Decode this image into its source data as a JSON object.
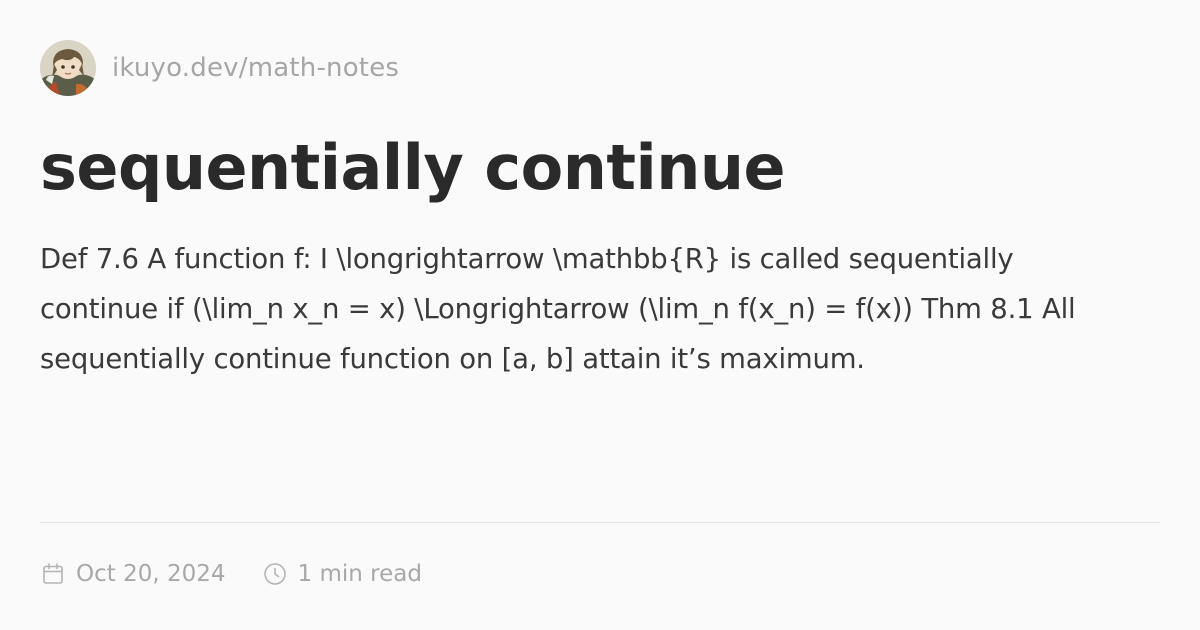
{
  "site": {
    "avatar_icon": "avatar-illustration",
    "url": "ikuyo.dev/math-notes"
  },
  "post": {
    "title": "sequentially continue",
    "excerpt": "Def 7.6 A function f: I \\longrightarrow \\mathbb{R} is called sequentially continue if (\\lim_n x_n = x) \\Longrightarrow (\\lim_n f(x_n) = f(x)) Thm 8.1 All sequentially continue function on [a, b] attain it’s maximum."
  },
  "meta": {
    "date_icon": "calendar-icon",
    "date": "Oct 20, 2024",
    "read_icon": "clock-icon",
    "reading_time": "1 min read"
  }
}
